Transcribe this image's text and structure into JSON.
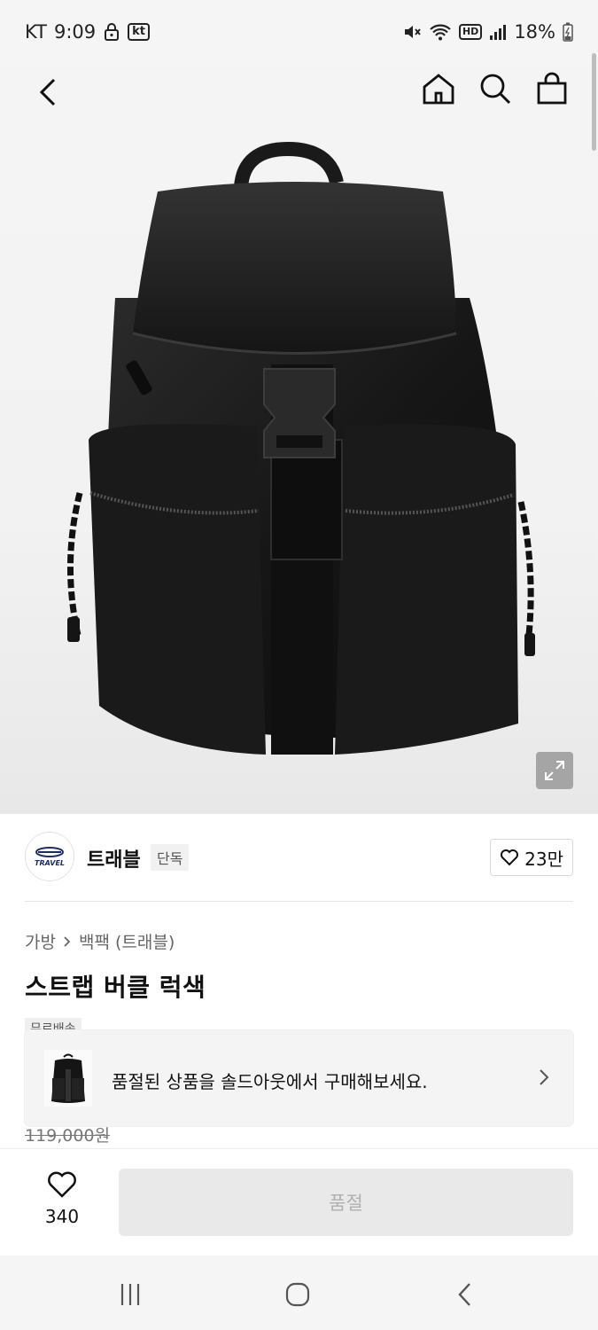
{
  "status_bar": {
    "carrier": "KT",
    "time": "9:09",
    "carrier_badge": "kt",
    "battery": "18%",
    "signal_badge": "HD"
  },
  "product": {
    "brand": {
      "name": "트래블",
      "tag": "단독",
      "logo_text": "TRAVEL",
      "likes": "23만"
    },
    "breadcrumb": {
      "category": "가방",
      "subcategory": "백팩 (트래블)"
    },
    "title": "스트랩 버클 럭색",
    "free_shipping": "무료배송",
    "original_price": "119,000원"
  },
  "soldout_banner": {
    "text": "품절된 상품을 솔드아웃에서 구매해보세요."
  },
  "bottom": {
    "wish_count": "340",
    "cta_label": "품절"
  },
  "colors": {
    "accent": "#111111",
    "cta_disabled_bg": "#e9e9e9",
    "cta_disabled_text": "#b0b0b0"
  }
}
